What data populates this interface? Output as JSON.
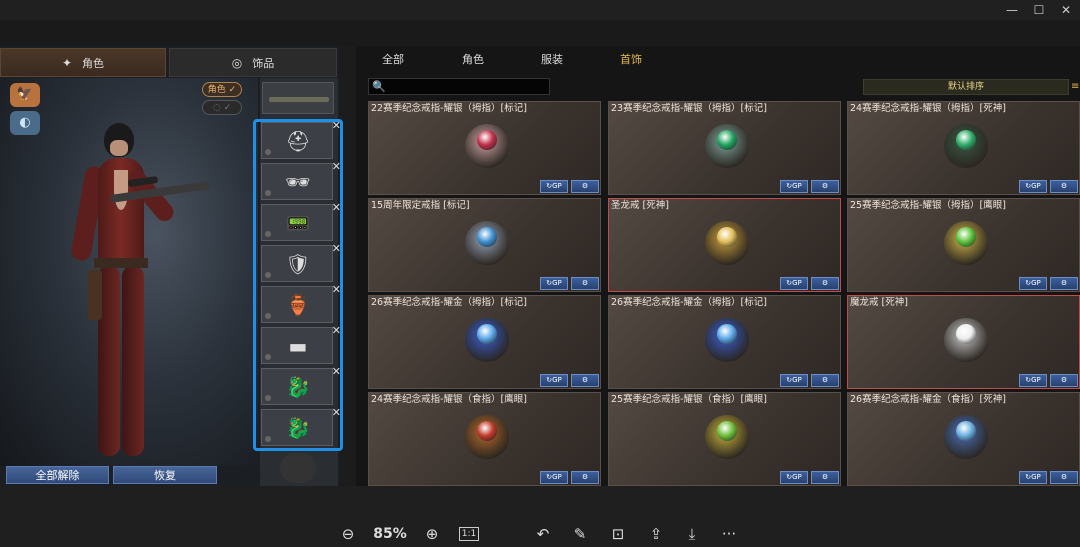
{
  "window": {
    "controls": [
      "—",
      "☐",
      "✕"
    ]
  },
  "left_tabs": [
    {
      "label": "角色",
      "icon": "figure-icon"
    },
    {
      "label": "饰品",
      "icon": "ring-icon"
    }
  ],
  "stage": {
    "emblems": [
      "eagle-emblem-icon",
      "mask-emblem-icon"
    ],
    "role_toggle": "角色",
    "hide_toggle": "✓"
  },
  "slots": [
    {
      "item": "helmet",
      "glyph": "⛑"
    },
    {
      "item": "sunglasses",
      "glyph": "🕶"
    },
    {
      "item": "walkie-talkie",
      "glyph": "📟"
    },
    {
      "item": "gold-armor",
      "glyph": "🛡"
    },
    {
      "item": "green-vase",
      "glyph": "🏺"
    },
    {
      "item": "neon-band",
      "glyph": "▬"
    },
    {
      "item": "gold-dragon-ring",
      "glyph": "🐉"
    },
    {
      "item": "silver-dragon-ring",
      "glyph": "🐉"
    }
  ],
  "left_buttons": {
    "unequip_all": "全部解除",
    "restore": "恢复"
  },
  "categories": [
    {
      "label": "全部",
      "active": false
    },
    {
      "label": "角色",
      "active": false
    },
    {
      "label": "服装",
      "active": false
    },
    {
      "label": "首饰",
      "active": true
    }
  ],
  "search": {
    "placeholder": ""
  },
  "sort": {
    "label": "默认排序"
  },
  "items": [
    {
      "title": "22赛季纪念戒指-耀银（拇指）[标记]",
      "ring": "#c9a3a3",
      "gem": "#c0304a",
      "selected": false
    },
    {
      "title": "23赛季纪念戒指-耀银（拇指）[标记]",
      "ring": "#7fa29a",
      "gem": "#22a560",
      "selected": false
    },
    {
      "title": "24赛季纪念戒指-耀银（拇指）[死神]",
      "ring": "#3a5a45",
      "gem": "#2fae6a",
      "selected": false
    },
    {
      "title": "15周年限定戒指 [标记]",
      "ring": "#9aa4b8",
      "gem": "#3f8fd1",
      "selected": false
    },
    {
      "title": "圣龙戒 [死神]",
      "ring": "#c9a03c",
      "gem": "#e2bf5a",
      "selected": true
    },
    {
      "title": "25赛季纪念戒指-耀银（拇指）[鹰眼]",
      "ring": "#d1b64a",
      "gem": "#5cc43c",
      "selected": false
    },
    {
      "title": "26赛季纪念戒指-耀金（拇指）[标记]",
      "ring": "#3b5fd1",
      "gem": "#5aa9e8",
      "selected": false
    },
    {
      "title": "26赛季纪念戒指-耀金（拇指）[标记]",
      "ring": "#3b5fd1",
      "gem": "#5aa9e8",
      "selected": false
    },
    {
      "title": "魔龙戒 [死神]",
      "ring": "#c8c8c8",
      "gem": "#eeeeee",
      "selected": true
    },
    {
      "title": "24赛季纪念戒指-耀银（食指）[鹰眼]",
      "ring": "#b46a2a",
      "gem": "#c23a2a",
      "selected": false
    },
    {
      "title": "25赛季纪念戒指-耀银（食指）[鹰眼]",
      "ring": "#c7b23a",
      "gem": "#6cbf3a",
      "selected": false
    },
    {
      "title": "26赛季纪念戒指-耀金（食指）[死神]",
      "ring": "#4a6fb8",
      "gem": "#6aaee0",
      "selected": false
    }
  ],
  "item_buttons": {
    "gp": "GP",
    "gear": "⚙"
  },
  "viewer": {
    "zoom": "85%",
    "one_to_one": "1:1",
    "more": "···"
  }
}
